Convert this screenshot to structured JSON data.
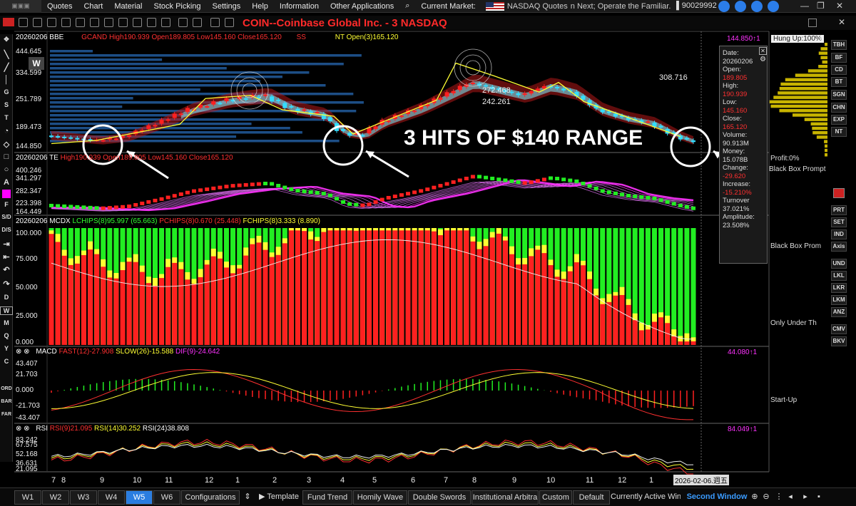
{
  "menubar": {
    "items": [
      "Quotes",
      "Chart",
      "Material",
      "Stock Picking",
      "Settings",
      "Help",
      "Information",
      "Other Applications"
    ],
    "current_market_label": "Current Market:",
    "market_name": "NASDAQ Quotes",
    "marquee": "n Next; Operate the Familiar.",
    "account": "90029992"
  },
  "instrument_title": "COIN--Coinbase Global Inc. - 3  NASDAQ",
  "main_pane": {
    "date_code": "20260206 BBE",
    "ohlc": "GCAND High190.939 Open189.805 Low145.160 Close165.120",
    "ss": "SS",
    "nt": "NT Open(3)165.120",
    "right_value": "144.850↑1",
    "hung_up": "Hung Up:100%",
    "y_ticks": [
      "444.645",
      "334.599",
      "251.789",
      "189.473",
      "144.850"
    ],
    "price_labels": [
      "308.716",
      "272.468",
      "242.261"
    ],
    "period_badge": "W"
  },
  "annotation": "3 HITS OF $140 RANGE",
  "ta_pane": {
    "date_code": "20260206 TE",
    "ohlc": "High190.939 Open189.805 Low145.160 Close165.120",
    "y_ticks": [
      "400.246",
      "341.297",
      "282.347",
      "223.398",
      "164.449"
    ]
  },
  "mcdx_pane": {
    "date_code": "20260206 MCDX",
    "lchips": "LCHIPS(8)95.997 (65.663)",
    "pchips": "PCHIPS(8)0.670 (25.448)",
    "fchips": "FCHIPS(8)3.333 (8.890)",
    "y_ticks": [
      "100.000",
      "75.000",
      "50.000",
      "25.000",
      "0.000"
    ]
  },
  "macd_pane": {
    "title": "MACD",
    "fast": "FAST(12)-27.908",
    "slow": "SLOW(26)-15.588",
    "dif": "DIF(9)-24.642",
    "right_value": "44.080↑1",
    "y_ticks": [
      "43.407",
      "21.703",
      "0.000",
      "-21.703",
      "-43.407"
    ]
  },
  "rsi_pane": {
    "title": "RSI",
    "rsi9": "RSI(9)21.095",
    "rsi14": "RSI(14)30.252",
    "rsi24": "RSI(24)38.808",
    "right_value": "84.049↑1",
    "y_ticks": [
      "83.242",
      "67.575",
      "52.168",
      "36.631",
      "21.095"
    ]
  },
  "x_axis": {
    "labels": [
      "7",
      "8",
      "9",
      "10",
      "11",
      "12",
      "1",
      "2",
      "3",
      "4",
      "5",
      "6",
      "7",
      "8",
      "9",
      "10",
      "11",
      "12",
      "1"
    ],
    "cursor_date": "2026-02-06.週五"
  },
  "info_panel": {
    "rows": [
      {
        "label": "Date:",
        "value": "20260206",
        "color": "#dddddd"
      },
      {
        "label": "Open:",
        "value": "189.805",
        "color": "#ff3030"
      },
      {
        "label": "High:",
        "value": "190.939",
        "color": "#ff3030"
      },
      {
        "label": "Low:",
        "value": "145.160",
        "color": "#ff3030"
      },
      {
        "label": "Close:",
        "value": "165.120",
        "color": "#ff3030"
      },
      {
        "label": "Volume:",
        "value": "90.913M",
        "color": "#dddddd"
      },
      {
        "label": "Money:",
        "value": "15.078B",
        "color": "#dddddd"
      },
      {
        "label": "Change:",
        "value": "-29.620",
        "color": "#ff3030"
      },
      {
        "label": "Increase:",
        "value": "-15.210%",
        "color": "#ff3030"
      },
      {
        "label": "Turnover",
        "value": "37.021%",
        "color": "#dddddd"
      },
      {
        "label": "Amplitude:",
        "value": "23.508%",
        "color": "#dddddd"
      }
    ]
  },
  "right_sidebar": {
    "buttons": [
      "TBH",
      "BF",
      "CD",
      "BT",
      "SGN",
      "CHN",
      "EXP",
      "NT",
      "PRT",
      "SET",
      "IND",
      "Axis",
      "UND",
      "LKL",
      "LKR",
      "LKM",
      "ANZ",
      "CMV",
      "BKV"
    ],
    "labels": [
      "Profit:0%",
      "Black Box Prompt",
      "Black Box Prom",
      "Only Under Th",
      "Start-Up"
    ]
  },
  "left_tools": [
    "G",
    "S",
    "T",
    "F",
    "S/D",
    "D/S",
    "D",
    "W",
    "M",
    "Q",
    "Y",
    "C",
    "ORD",
    "BAR",
    "FAR"
  ],
  "bottom_tabs": {
    "week_tabs": [
      "W1",
      "W2",
      "W3",
      "W4",
      "W5",
      "W6"
    ],
    "active_tab": "W5",
    "configurations": "Configurations",
    "template": "Template",
    "tabs": [
      "Fund Trend",
      "Homily Wave",
      "Double Swords",
      "Institutional Arbitra",
      "Custom",
      "Default"
    ],
    "current_window": "Currently Active Winc",
    "second_window": "Second Window"
  },
  "colors": {
    "accent_blue": "#2a7de0",
    "red": "#ff2020",
    "green": "#22ee22",
    "yellow": "#ffff33",
    "cyan": "#33ddff",
    "magenta": "#ff33ff"
  }
}
